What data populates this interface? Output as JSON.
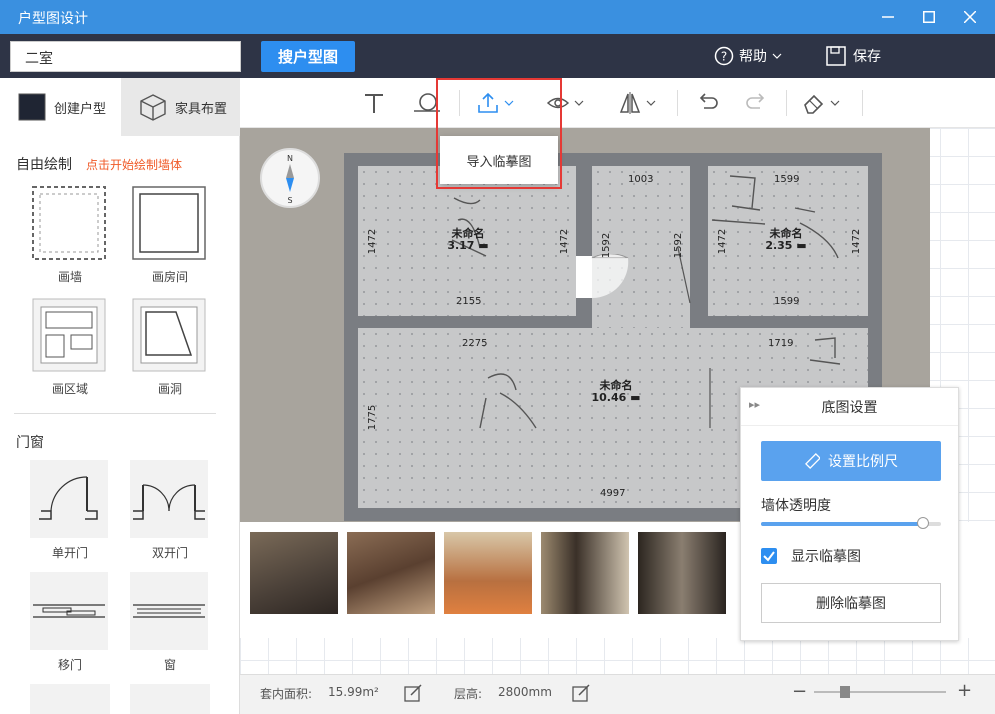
{
  "window": {
    "title": "户型图设计"
  },
  "header": {
    "plan_name": "二室",
    "search_label": "搜户型图",
    "help_label": "帮助",
    "save_label": "保存"
  },
  "left_panel": {
    "tabs": [
      {
        "label": "创建户型"
      },
      {
        "label": "家具布置"
      }
    ],
    "free_draw": {
      "title": "自由绘制",
      "hint": "点击开始绘制墙体",
      "tools": [
        {
          "label": "画墙"
        },
        {
          "label": "画房间"
        },
        {
          "label": "画区域"
        },
        {
          "label": "画洞"
        }
      ]
    },
    "doors_windows": {
      "title": "门窗",
      "items": [
        {
          "label": "单开门"
        },
        {
          "label": "双开门"
        },
        {
          "label": "移门"
        },
        {
          "label": "窗"
        }
      ]
    }
  },
  "toolbar": {
    "import_menu_item": "导入临摹图"
  },
  "canvas": {
    "compass": {
      "n": "N",
      "s": "S"
    },
    "rooms": [
      {
        "name": "未命名",
        "area": "3.17"
      },
      {
        "name": "未命名",
        "area": "2.35"
      },
      {
        "name": "未命名",
        "area": "10.46"
      }
    ],
    "dims": {
      "top_left": "2155",
      "top_mid": "1003",
      "top_right": "1599",
      "mid_left": "2155",
      "mid_right": "1599",
      "v1": "1472",
      "v2": "1472",
      "v3": "1592",
      "v4": "1592",
      "v5": "1472",
      "v6": "1472",
      "hall_w": "2275",
      "hall_r": "1719",
      "hall_v": "1775",
      "bottom": "4997"
    }
  },
  "settings_panel": {
    "title": "底图设置",
    "scale_button": "设置比例尺",
    "opacity_label": "墙体透明度",
    "opacity_value": 0.9,
    "show_label": "显示临摹图",
    "show_checked": true,
    "delete_button": "删除临摹图"
  },
  "footer": {
    "area_label": "套内面积:",
    "area_value": "15.99m²",
    "height_label": "层高:",
    "height_value": "2800mm"
  },
  "colors": {
    "titlebar": "#3a90e0",
    "header": "#2e3446",
    "accent": "#2d8ef0",
    "hint": "#f05a28",
    "highlight": "#e53935"
  }
}
